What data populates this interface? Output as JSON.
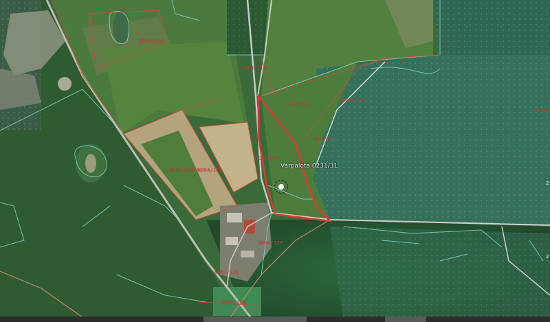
{
  "map": {
    "title": "Várpalota 0231/31",
    "selected_parcel_label": "Várpalota 0231/31",
    "parcel_codes": [
      {
        "id": "c1",
        "text": "KKK4/122"
      },
      {
        "id": "c2",
        "text": "KK4/118"
      },
      {
        "id": "c3",
        "text": "KKK4/26"
      },
      {
        "id": "c4",
        "text": "KKK4/24"
      },
      {
        "id": "c5",
        "text": "KKK4/66"
      },
      {
        "id": "c6",
        "text": "KK4/45"
      },
      {
        "id": "c7",
        "text": "KKK4/86"
      },
      {
        "id": "c8",
        "text": "KKK4/120"
      },
      {
        "id": "c9",
        "text": "KKK4/43871"
      },
      {
        "id": "c10",
        "text": "KKK4/121"
      },
      {
        "id": "c11",
        "text": "KKK4/127"
      },
      {
        "id": "c12",
        "text": "KKK4/129"
      },
      {
        "id": "c13",
        "text": "KKK4/130"
      }
    ],
    "edge_marks": [
      {
        "id": "e1",
        "text": "2"
      },
      {
        "id": "e2",
        "text": "2"
      }
    ],
    "colors": {
      "parcel_boundary": "#d8463b",
      "selected_boundary": "#e2382f",
      "cadastral_line": "#7fd6c8",
      "road": "#c9c9c9",
      "water_overlay": "#2f6a55",
      "field_light": "#c3b38a"
    },
    "icons": {
      "marker": "location-marker-icon"
    }
  }
}
